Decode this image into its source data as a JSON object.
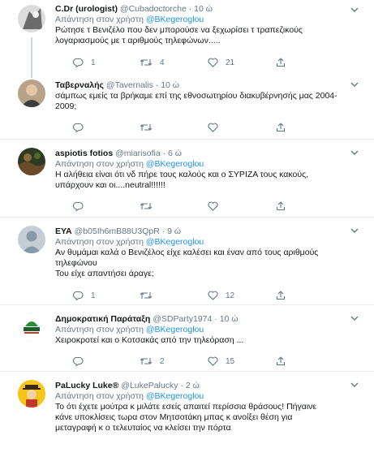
{
  "reply_prefix": "Απάντηση στον χρήστη",
  "tweets": [
    {
      "name": "C.Dr (urologist)",
      "handle": "@Cubadoctorche",
      "time": "10 ώ",
      "reply_to": "@BKegeroglou",
      "text_lines": [
        "Ρώτησε τ Βενιζέλο που δεν μπορούσε να ξεχωρίσει τ τραπεζικούς",
        "λογαριασμούς με τ αριθμούς τηλεφώνων....."
      ],
      "replies": "1",
      "retweets": "4",
      "likes": "21"
    },
    {
      "name": "Ταβερναλής",
      "handle": "@Tavernalis",
      "time": "10 ώ",
      "reply_to": "",
      "text_lines": [
        "σάμπως εμείς τα βρήκαμε επί της εθνοσωτηρίου διακυβέρνησής μας 2004-",
        "2009;"
      ],
      "replies": "",
      "retweets": "",
      "likes": ""
    },
    {
      "name": "aspiotis fotios",
      "handle": "@miarisofia",
      "time": "6 ώ",
      "reply_to": "@BKegeroglou",
      "text_lines": [
        "Η αλήθεια είναι ότι νδ πήρε τους καλούς και ο ΣΥΡΙΖΑ τους κακούς,",
        "υπάρχουν και οι....neutral!!!!!!"
      ],
      "replies": "",
      "retweets": "",
      "likes": ""
    },
    {
      "name": "ΕΥΑ",
      "handle": "@b05Ih6mB88U3QpR",
      "time": "9 ώ",
      "reply_to": "@BKegeroglou",
      "text_lines": [
        "Αν θυμάμαι καλά ο Βενιζέλος είχε καλέσει και έναν  από τους αριθμούς",
        "τηλεφώνου",
        "Του είχε απαντήσει άραγε;"
      ],
      "replies": "1",
      "retweets": "",
      "likes": "12"
    },
    {
      "name": "Δημοκρατική Παράταξη",
      "handle": "@SDParty1974",
      "time": "10 ώ",
      "reply_to": "@BKegeroglou",
      "text_lines": [
        "Χειροκροτεί και ο Κοτσακάς από την τηλεόραση ..."
      ],
      "replies": "",
      "retweets": "2",
      "likes": "15"
    },
    {
      "name": "PaLucky Luke®",
      "handle": "@LukePalucky",
      "time": "2 ώ",
      "reply_to": "@BKegeroglou",
      "text_lines": [
        "Το ότι έχετε μούτρα κ μιλάτε εσείς απαιτεί περίσσια θράσους! Πήγαινε",
        "κάνε υποκλίσεις τωρα στον Μητσοτάκη μπας κ ανοίξει θέση για",
        "μεταγραφή κ ο τελευταίος να κλείσει την πόρτα"
      ],
      "replies": "",
      "retweets": "",
      "likes": ""
    }
  ],
  "colors": {
    "link": "#1b95e0",
    "muted": "#657786",
    "text": "#14171a",
    "divider": "#e6ecf0"
  }
}
